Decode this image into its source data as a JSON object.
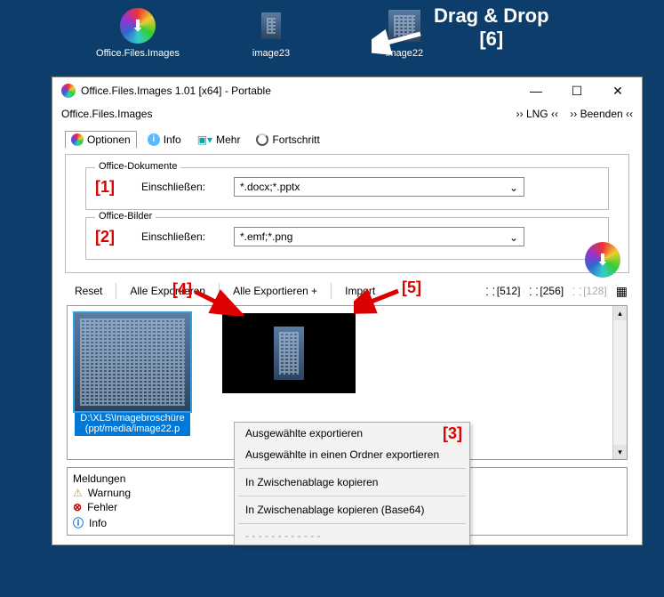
{
  "desktop": {
    "icons": [
      {
        "label": "Office.Files.Images"
      },
      {
        "label": "image23"
      },
      {
        "label": "image22"
      }
    ],
    "annotation": "Drag & Drop",
    "annotation_num": "[6]"
  },
  "window": {
    "title": "Office.Files.Images 1.01 [x64] - Portable",
    "menu_left": "Office.Files.Images",
    "menu_right_lng": "›› LNG ‹‹",
    "menu_right_exit": "›› Beenden ‹‹",
    "tabs": {
      "options": "Optionen",
      "info": "Info",
      "more": "Mehr",
      "progress": "Fortschritt"
    },
    "group_docs": {
      "legend": "Office-Dokumente",
      "num": "[1]",
      "label": "Einschließen:",
      "value": "*.docx;*.pptx"
    },
    "group_imgs": {
      "legend": "Office-Bilder",
      "num": "[2]",
      "label": "Einschließen:",
      "value": "*.emf;*.png"
    },
    "toolbar": {
      "reset": "Reset",
      "exp_all": "Alle Exportieren",
      "exp_all_plus": "Alle Exportieren +",
      "import": "Import",
      "num4": "[4]",
      "num5": "[5]",
      "size512": "[512]",
      "size256": "[256]",
      "size128": "[128]"
    },
    "gallery": {
      "item1_caption": "D:\\XLS\\Imagebroschüre (ppt/media/image22.p",
      "item2_caption": ""
    },
    "context_menu": {
      "i1": "Ausgewählte exportieren",
      "i2": "Ausgewählte in einen Ordner exportieren",
      "i3": "In Zwischenablage kopieren",
      "i4": "In Zwischenablage kopieren (Base64)",
      "dots": "- - - - - - - - - - - -",
      "num3": "[3]"
    },
    "messages": {
      "header": "Meldungen",
      "warn": "Warnung",
      "err": "Fehler",
      "info": "Info"
    }
  }
}
